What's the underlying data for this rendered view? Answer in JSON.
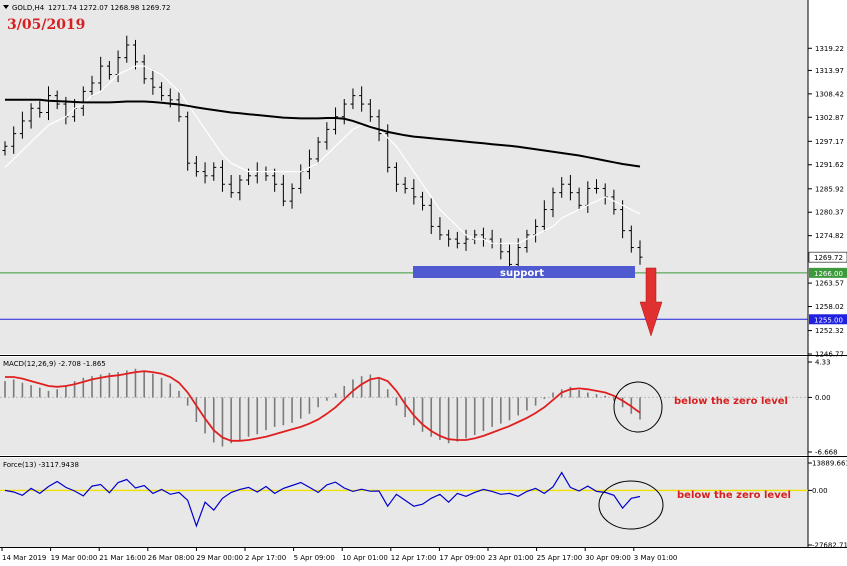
{
  "header": {
    "symbol": "GOLD,H4",
    "ohlc": "1271.74 1272.07 1268.98 1269.72",
    "date_label": "3/05/2019"
  },
  "chart_data": [
    {
      "type": "line",
      "panel": "price",
      "y_ticks": [
        "1319.22",
        "1313.97",
        "1308.42",
        "1302.87",
        "1297.17",
        "1291.62",
        "1285.92",
        "1280.37",
        "1274.82",
        "1269.72",
        "1263.57",
        "1258.02",
        "1252.32",
        "1246.77"
      ],
      "ylim": [
        1246.77,
        1324.5
      ],
      "last_price": "1269.72",
      "levels": [
        {
          "label": "1266.00",
          "value": 1266.0,
          "color": "#3c9a3c"
        },
        {
          "label": "1255.00",
          "value": 1255.0,
          "color": "#2020e0"
        }
      ],
      "series": [
        {
          "kind": "candles",
          "color": "#000000",
          "close": [
            1296,
            1299,
            1302,
            1305,
            1304,
            1308,
            1306,
            1303,
            1305,
            1309,
            1311,
            1315,
            1313,
            1317,
            1320,
            1316,
            1312,
            1310,
            1308,
            1307,
            1303,
            1292,
            1290,
            1289,
            1291,
            1287,
            1285,
            1288,
            1289,
            1290,
            1289,
            1287,
            1283,
            1286,
            1290,
            1293,
            1297,
            1300,
            1303,
            1306,
            1308,
            1306,
            1303,
            1299,
            1291,
            1287,
            1286,
            1284,
            1282,
            1277,
            1275,
            1274,
            1273,
            1274,
            1275,
            1274,
            1273,
            1271,
            1268,
            1272,
            1275,
            1277,
            1281,
            1285,
            1287,
            1285,
            1282,
            1286,
            1286,
            1284,
            1281,
            1276,
            1272,
            1269.72
          ]
        },
        {
          "name": "",
          "kind": "sma-white",
          "color": "#ffffff",
          "values": [
            1291,
            1293,
            1295,
            1297,
            1299,
            1301,
            1302,
            1303,
            1305,
            1306,
            1308,
            1309,
            1311,
            1313,
            1314,
            1315,
            1315,
            1314,
            1313,
            1311,
            1309,
            1306,
            1303,
            1300,
            1297,
            1294,
            1292,
            1291,
            1290,
            1290,
            1290,
            1290,
            1290,
            1290,
            1290,
            1291,
            1292,
            1294,
            1296,
            1298,
            1300,
            1301,
            1301,
            1300,
            1298,
            1296,
            1293,
            1290,
            1287,
            1284,
            1281,
            1279,
            1277,
            1275,
            1274,
            1274,
            1273,
            1273,
            1273,
            1273,
            1274,
            1275,
            1276,
            1277,
            1279,
            1280,
            1281,
            1282,
            1283,
            1284,
            1283,
            1282,
            1281,
            1280
          ]
        },
        {
          "name": "",
          "kind": "sma-black",
          "color": "#000000",
          "values": [
            1307,
            1307,
            1307,
            1307,
            1307,
            1306.8,
            1306.7,
            1306.6,
            1306.5,
            1306.4,
            1306.4,
            1306.4,
            1306.4,
            1306.5,
            1306.6,
            1306.6,
            1306.6,
            1306.5,
            1306.3,
            1306.1,
            1305.9,
            1305.6,
            1305.2,
            1304.9,
            1304.6,
            1304.3,
            1304,
            1303.8,
            1303.6,
            1303.4,
            1303.2,
            1303,
            1302.8,
            1302.7,
            1302.6,
            1302.6,
            1302.6,
            1302.7,
            1302.7,
            1302.5,
            1302,
            1301.3,
            1300.6,
            1300,
            1299.4,
            1299,
            1298.6,
            1298.3,
            1298.1,
            1297.9,
            1297.7,
            1297.5,
            1297.3,
            1297.1,
            1296.9,
            1296.7,
            1296.5,
            1296.3,
            1296.1,
            1295.9,
            1295.6,
            1295.3,
            1295,
            1294.7,
            1294.4,
            1294.1,
            1293.8,
            1293.4,
            1293,
            1292.6,
            1292.2,
            1291.8,
            1291.5,
            1291.2
          ]
        }
      ],
      "annotations": [
        {
          "text": "support",
          "from": 1266.0,
          "to": 1263.6
        }
      ]
    },
    {
      "type": "bar",
      "panel": "macd",
      "title": "MACD(12,26,9) -2.708 -1.865",
      "y_ticks": [
        "4.33",
        "0.00",
        "-6.668"
      ],
      "ylim": [
        -6.668,
        4.33
      ],
      "series": [
        {
          "name": "",
          "kind": "histogram",
          "color": "#808080",
          "values": [
            2,
            2.2,
            1.8,
            1.5,
            1.2,
            0.8,
            1,
            1.5,
            2,
            2.4,
            2.6,
            2.8,
            3,
            3.1,
            3.3,
            3.5,
            3.2,
            2.9,
            2.4,
            1.7,
            0.8,
            -1,
            -3,
            -4.4,
            -5.5,
            -6,
            -5.6,
            -5.2,
            -4.8,
            -4.5,
            -4,
            -3.6,
            -3.4,
            -3.1,
            -2.6,
            -2,
            -1.2,
            -0.4,
            0.5,
            1.4,
            2.2,
            2.6,
            2.8,
            2.4,
            1,
            -1,
            -2.4,
            -3.4,
            -4.2,
            -4.8,
            -5.2,
            -5.6,
            -5.4,
            -5,
            -4.6,
            -4.1,
            -3.6,
            -3.2,
            -2.8,
            -2.2,
            -1.6,
            -1,
            -0.2,
            0.6,
            1,
            1.3,
            0.9,
            0.6,
            0.4,
            0.2,
            -0.4,
            -1.2,
            -2,
            -2.708
          ]
        },
        {
          "name": "",
          "kind": "signal",
          "color": "#e02020",
          "values": [
            2.5,
            2.5,
            2.3,
            2,
            1.7,
            1.4,
            1.3,
            1.4,
            1.6,
            1.9,
            2.2,
            2.4,
            2.6,
            2.7,
            2.9,
            3.1,
            3.2,
            3.1,
            2.9,
            2.5,
            1.8,
            0.6,
            -1,
            -2.6,
            -4,
            -4.9,
            -5.3,
            -5.3,
            -5.2,
            -5,
            -4.8,
            -4.5,
            -4.2,
            -3.9,
            -3.6,
            -3.2,
            -2.7,
            -2,
            -1.2,
            -0.2,
            0.8,
            1.6,
            2.2,
            2.4,
            2,
            0.8,
            -0.8,
            -2.2,
            -3.3,
            -4.1,
            -4.7,
            -5.1,
            -5.2,
            -5.2,
            -5,
            -4.7,
            -4.3,
            -3.9,
            -3.5,
            -3,
            -2.5,
            -1.9,
            -1.2,
            -0.3,
            0.6,
            1,
            1.1,
            1,
            0.8,
            0.6,
            0.2,
            -0.4,
            -1.1,
            -1.865
          ]
        }
      ],
      "annotations": [
        {
          "text": "below the zero level"
        }
      ]
    },
    {
      "type": "line",
      "panel": "force",
      "title": "Force(13) -3117.9438",
      "y_ticks": [
        "13889.661",
        "0.00",
        "-27682.71"
      ],
      "ylim": [
        -27682.71,
        13889.661
      ],
      "zero_line_color": "#f0e000",
      "series": [
        {
          "name": "",
          "kind": "force",
          "color": "#0000cc",
          "values": [
            0,
            -800,
            -2500,
            1000,
            -1500,
            2000,
            4500,
            1500,
            -300,
            -2800,
            2200,
            3000,
            -1200,
            4000,
            5500,
            1200,
            2500,
            -1500,
            500,
            -2000,
            -1000,
            -5000,
            -18000,
            -6000,
            -10000,
            -4000,
            -1000,
            500,
            1500,
            -800,
            2000,
            -1500,
            1000,
            2500,
            4000,
            1500,
            -1000,
            2800,
            4200,
            1200,
            -500,
            600,
            -400,
            -300,
            -8000,
            -2000,
            -5000,
            -8000,
            -7000,
            -4000,
            -2000,
            -6000,
            -1500,
            -3000,
            -1000,
            500,
            -500,
            -2000,
            -1500,
            -3000,
            -500,
            1000,
            -1500,
            1800,
            9000,
            1500,
            -300,
            2200,
            -500,
            -1000,
            -2500,
            -9000,
            -4000,
            -3117.9438
          ]
        }
      ],
      "annotations": [
        {
          "text": "below the zero level"
        }
      ]
    }
  ],
  "x_axis": {
    "labels": [
      "14 Mar 2019",
      "19 Mar 00:00",
      "21 Mar 16:00",
      "26 Mar 08:00",
      "29 Mar 00:00",
      "2 Apr 17:00",
      "5 Apr 09:00",
      "10 Apr 01:00",
      "12 Apr 17:00",
      "17 Apr 09:00",
      "23 Apr 01:00",
      "25 Apr 17:00",
      "30 Apr 09:00",
      "3 May 01:00"
    ]
  }
}
